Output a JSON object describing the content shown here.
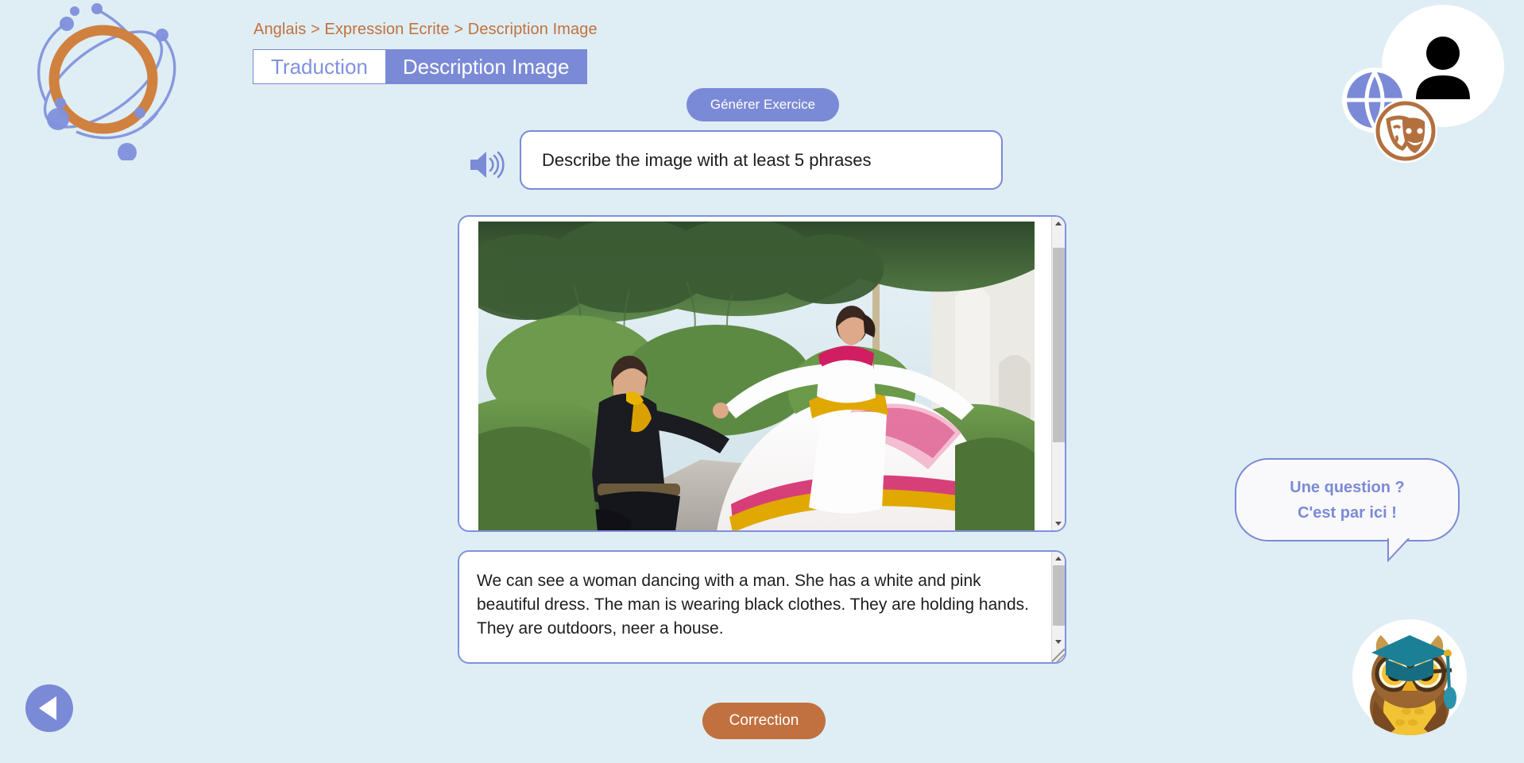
{
  "app": {
    "logo_name": "atom-logo",
    "background_color": "#dfeef4",
    "accent_blue": "#7b8ad6",
    "accent_orange": "#c1713f"
  },
  "breadcrumb": {
    "text": "Anglais > Expression Ecrite > Description Image",
    "parts": [
      "Anglais",
      "Expression Ecrite",
      "Description Image"
    ],
    "separator": ">",
    "color": "#c1713f"
  },
  "tabs": [
    {
      "label": "Traduction",
      "active": false
    },
    {
      "label": "Description Image",
      "active": true
    }
  ],
  "toolbar": {
    "generate_label": "Générer Exercice"
  },
  "instruction": {
    "speaker_icon": "megaphone-icon",
    "text": "Describe the image with at least 5 phrases"
  },
  "exercise_image": {
    "alt": "Couple dancing traditional Mexican folk dance outdoors in a garden",
    "scroll_position": "top"
  },
  "answer": {
    "value": "We can see a woman dancing with a man. She has a white and pink beautiful dress. The man is wearing black clothes. They are holding hands. They are outdoors, neer a house.",
    "placeholder": ""
  },
  "actions": {
    "correction_label": "Correction",
    "back_icon": "back-arrow-icon"
  },
  "help": {
    "line1": "Une question ?",
    "line2": "C'est par ici !",
    "mascot": "owl-graduate-icon"
  },
  "account": {
    "avatar_icon": "user-avatar-icon",
    "badges": [
      {
        "name": "globe-icon",
        "color": "#7b8ad6"
      },
      {
        "name": "theater-masks-icon",
        "color": "#c1713f"
      }
    ]
  }
}
